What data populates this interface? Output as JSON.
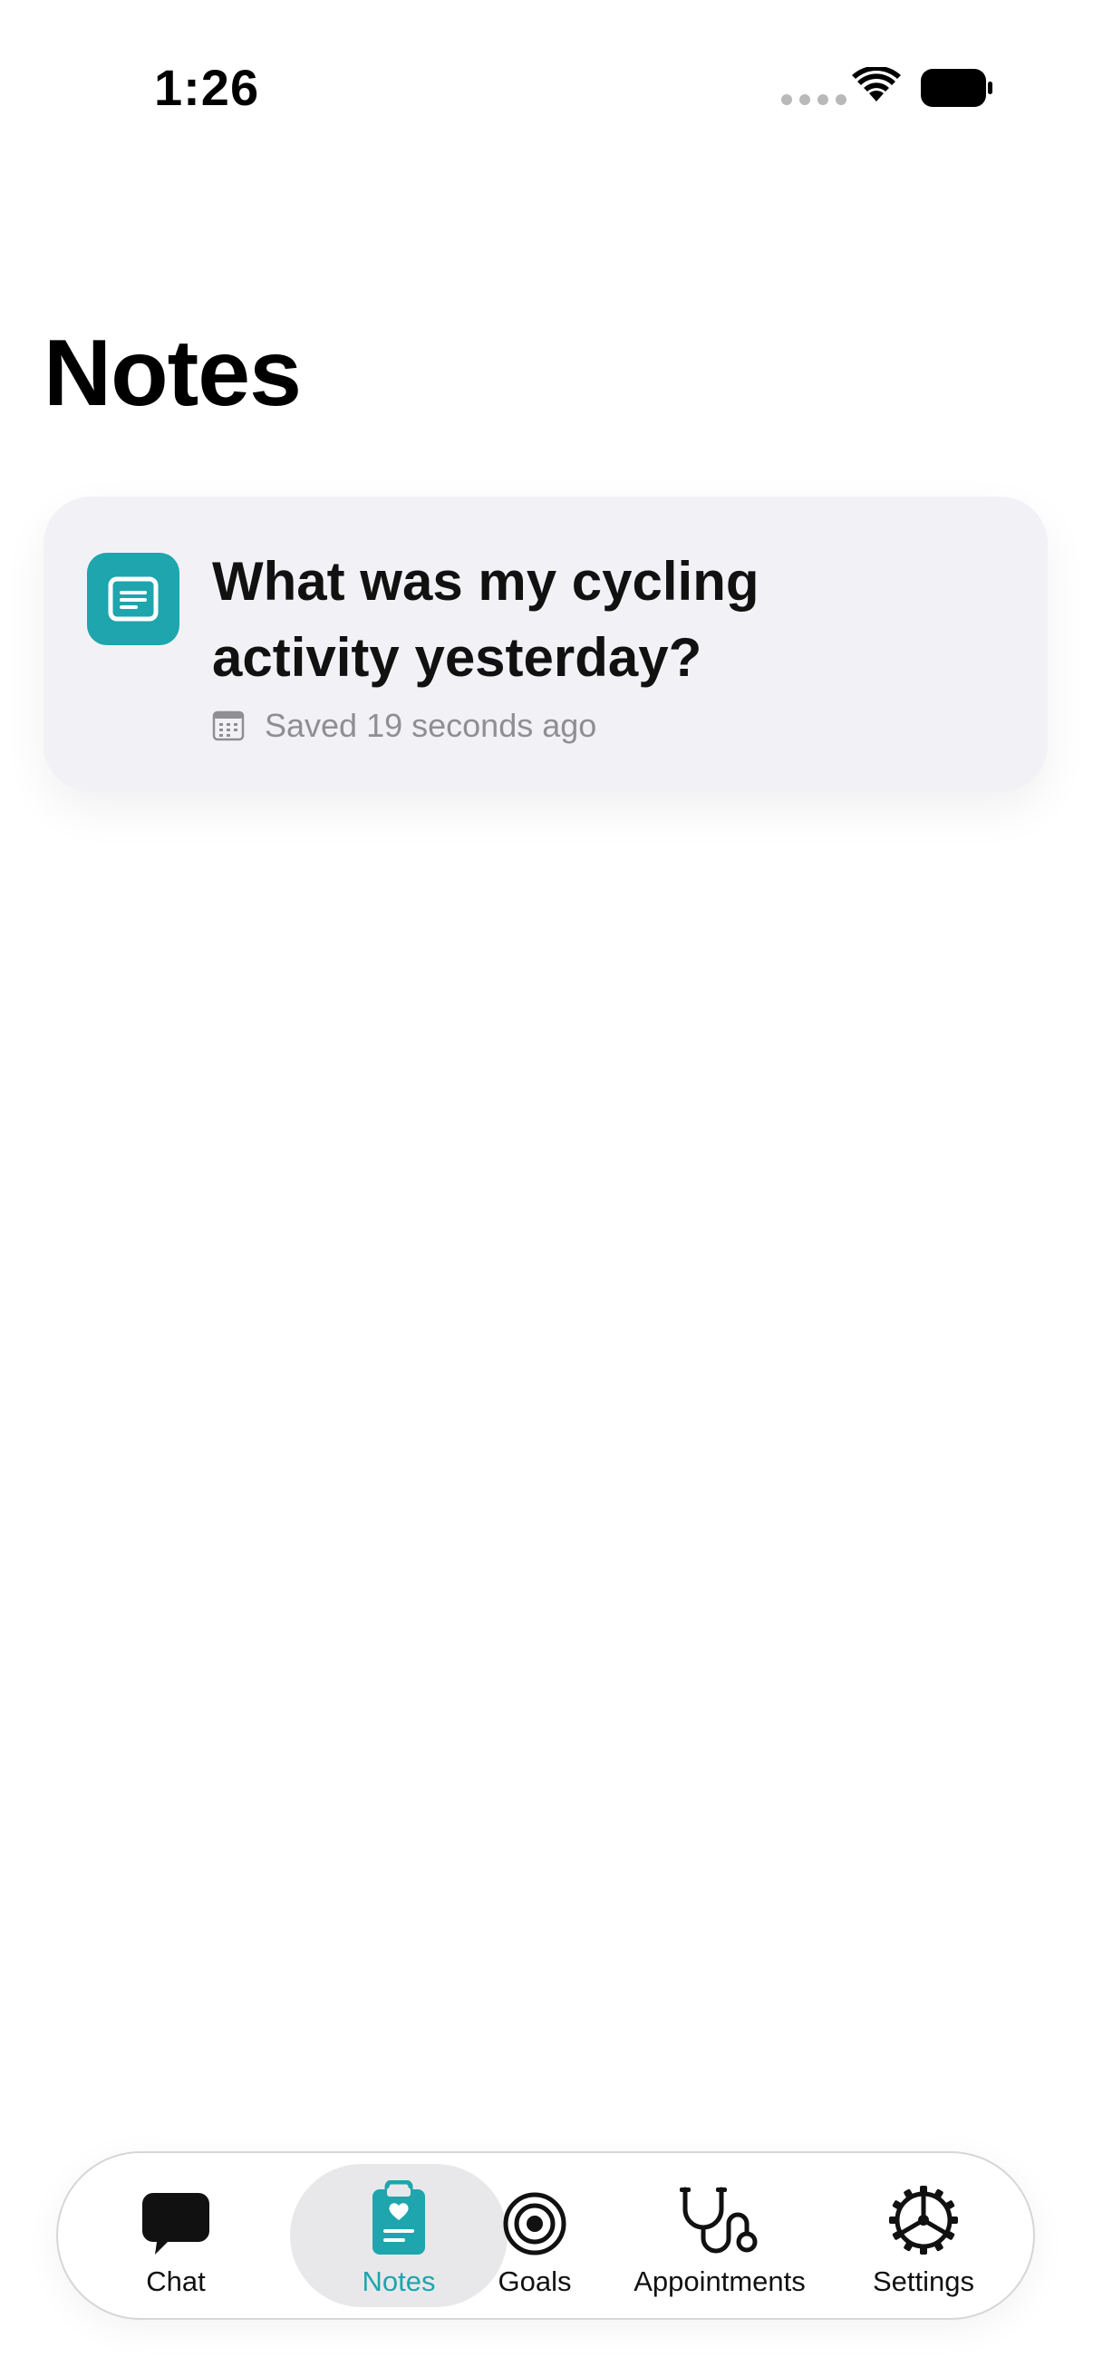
{
  "status_bar": {
    "time": "1:26"
  },
  "page": {
    "title": "Notes"
  },
  "notes": [
    {
      "title": "What was my cycling activity yesterday?",
      "saved_text": "Saved 19 seconds ago",
      "icon": "note-document-icon"
    }
  ],
  "tab_bar": {
    "active": "Notes",
    "tabs": [
      {
        "label": "Chat",
        "icon": "chat-bubble-icon"
      },
      {
        "label": "Notes",
        "icon": "clipboard-heart-icon"
      },
      {
        "label": "Goals",
        "icon": "target-icon"
      },
      {
        "label": "Appointments",
        "icon": "stethoscope-icon"
      },
      {
        "label": "Settings",
        "icon": "gear-icon"
      }
    ]
  },
  "colors": {
    "accent": "#1ea5ad",
    "card_background": "#f2f2f6",
    "secondary_text": "#8e8e93"
  }
}
